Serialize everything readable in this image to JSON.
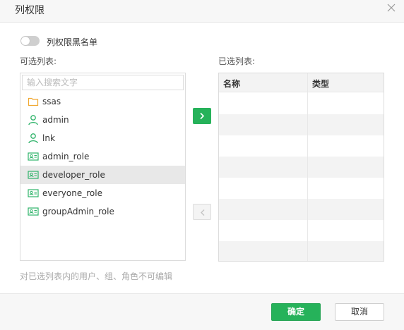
{
  "dialog": {
    "title": "列权限"
  },
  "blacklist": {
    "label": "列权限黑名单",
    "enabled": false
  },
  "available": {
    "label": "可选列表:",
    "search_placeholder": "输入搜索文字",
    "items": [
      {
        "label": "ssas",
        "icon": "folder-icon",
        "selected": false
      },
      {
        "label": "admin",
        "icon": "user-icon",
        "selected": false
      },
      {
        "label": "lnk",
        "icon": "user-icon",
        "selected": false
      },
      {
        "label": "admin_role",
        "icon": "role-card-icon",
        "selected": false
      },
      {
        "label": "developer_role",
        "icon": "role-card-icon",
        "selected": true
      },
      {
        "label": "everyone_role",
        "icon": "role-card-icon",
        "selected": false
      },
      {
        "label": "groupAdmin_role",
        "icon": "role-card-icon",
        "selected": false
      }
    ]
  },
  "selected_list": {
    "label": "已选列表:",
    "columns": [
      "名称",
      "类型"
    ],
    "rows": []
  },
  "note": "对已选列表内的用户、组、角色不可编辑",
  "footer": {
    "ok_label": "确定",
    "cancel_label": "取消"
  },
  "colors": {
    "accent": "#26b25a",
    "folder": "#f0a830",
    "user": "#2fb36a"
  }
}
